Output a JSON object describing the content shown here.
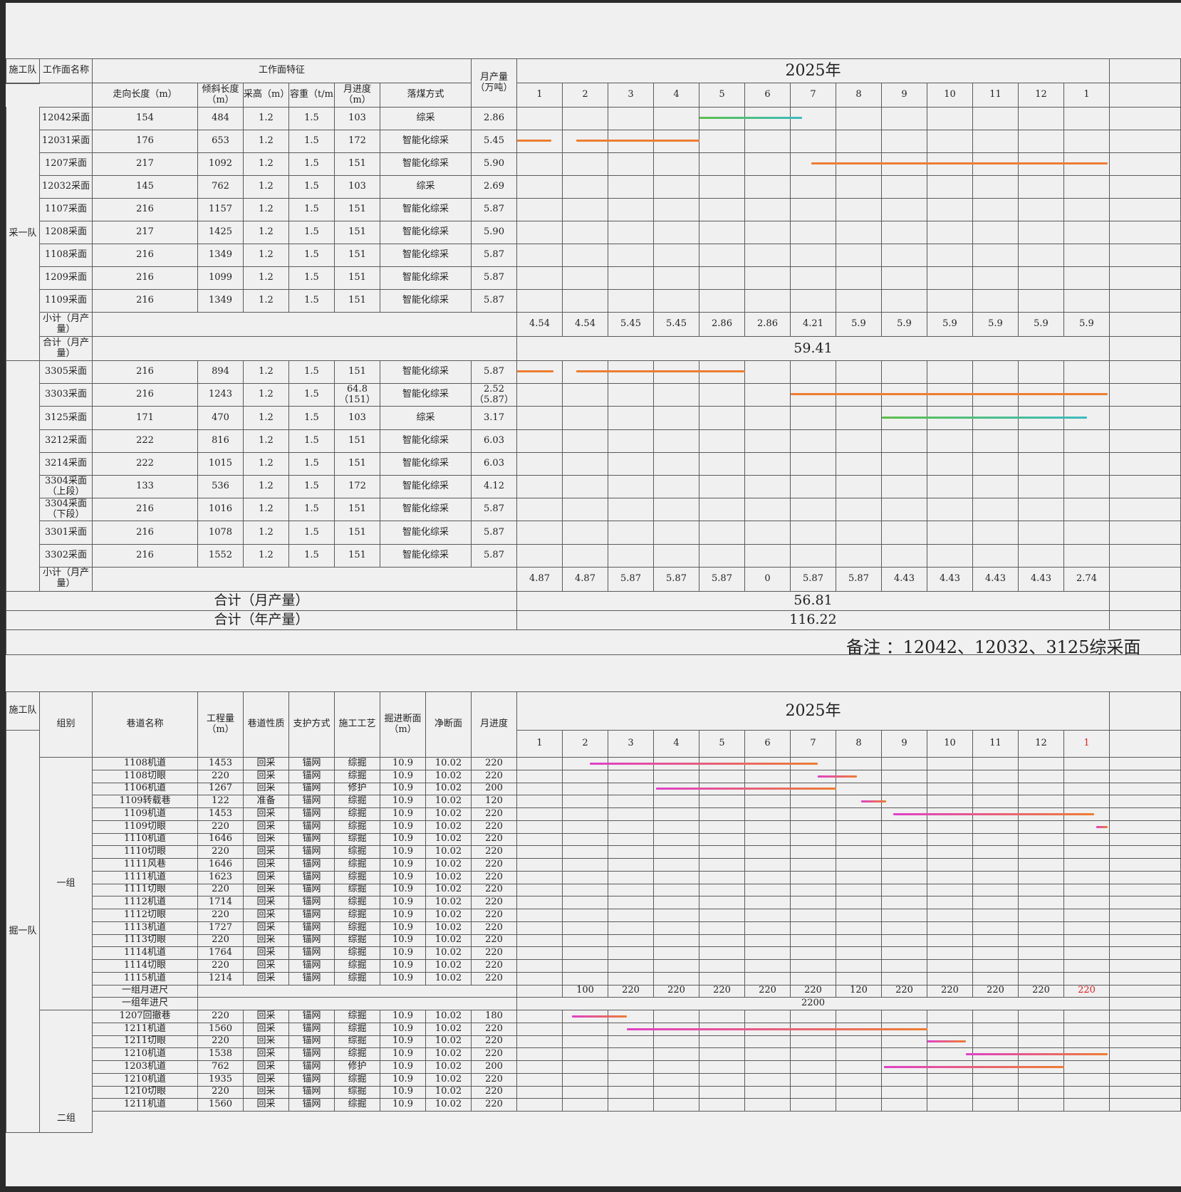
{
  "year_label": "2025年",
  "colors": {
    "orange": "#ed7d31",
    "green": "#5cbf4a",
    "teal": "#3cbcc0",
    "magenta": "#e040c8"
  },
  "months": [
    "1",
    "2",
    "3",
    "4",
    "5",
    "6",
    "7",
    "8",
    "9",
    "10",
    "11",
    "12",
    "1"
  ],
  "mining": {
    "header": {
      "team": "施工队",
      "face_name": "工作面名称",
      "features": "工作面特征",
      "monthly_output": "月产量\n（万吨）",
      "strike_length": "走向长度（m）",
      "incline_length": "倾斜长度\n（m）",
      "height": "采高（m）",
      "density": "容重（t/m",
      "monthly_advance": "月进度\n（m）",
      "method": "落煤方式"
    },
    "team1": "采一队",
    "group1_rows": [
      {
        "name": "12042采面",
        "strike": "154",
        "incline": "484",
        "height": "1.2",
        "density": "1.5",
        "advance": "103",
        "method": "综采",
        "output": "2.86"
      },
      {
        "name": "12031采面",
        "strike": "176",
        "incline": "653",
        "height": "1.2",
        "density": "1.5",
        "advance": "172",
        "method": "智能化综采",
        "output": "5.45"
      },
      {
        "name": "1207采面",
        "strike": "217",
        "incline": "1092",
        "height": "1.2",
        "density": "1.5",
        "advance": "151",
        "method": "智能化综采",
        "output": "5.90"
      },
      {
        "name": "12032采面",
        "strike": "145",
        "incline": "762",
        "height": "1.2",
        "density": "1.5",
        "advance": "103",
        "method": "综采",
        "output": "2.69"
      },
      {
        "name": "1107采面",
        "strike": "216",
        "incline": "1157",
        "height": "1.2",
        "density": "1.5",
        "advance": "151",
        "method": "智能化综采",
        "output": "5.87"
      },
      {
        "name": "1208采面",
        "strike": "217",
        "incline": "1425",
        "height": "1.2",
        "density": "1.5",
        "advance": "151",
        "method": "智能化综采",
        "output": "5.90"
      },
      {
        "name": "1108采面",
        "strike": "216",
        "incline": "1349",
        "height": "1.2",
        "density": "1.5",
        "advance": "151",
        "method": "智能化综采",
        "output": "5.87"
      },
      {
        "name": "1209采面",
        "strike": "216",
        "incline": "1099",
        "height": "1.2",
        "density": "1.5",
        "advance": "151",
        "method": "智能化综采",
        "output": "5.87"
      },
      {
        "name": "1109采面",
        "strike": "216",
        "incline": "1349",
        "height": "1.2",
        "density": "1.5",
        "advance": "151",
        "method": "智能化综采",
        "output": "5.87"
      }
    ],
    "subtotal_label": "小计（月产\n量）",
    "total_label": "合计（月产\n量）",
    "group1_subtotals": [
      "4.54",
      "4.54",
      "5.45",
      "5.45",
      "2.86",
      "2.86",
      "4.21",
      "5.9",
      "5.9",
      "5.9",
      "5.9",
      "5.9",
      "5.9"
    ],
    "group1_total": "59.41",
    "group2_rows": [
      {
        "name": "3305采面",
        "strike": "216",
        "incline": "894",
        "height": "1.2",
        "density": "1.5",
        "advance": "151",
        "method": "智能化综采",
        "output": "5.87"
      },
      {
        "name": "3303采面",
        "strike": "216",
        "incline": "1243",
        "height": "1.2",
        "density": "1.5",
        "advance": "64.8\n（151）",
        "method": "智能化综采",
        "output": "2.52\n（5.87）"
      },
      {
        "name": "3125采面",
        "strike": "171",
        "incline": "470",
        "height": "1.2",
        "density": "1.5",
        "advance": "103",
        "method": "综采",
        "output": "3.17"
      },
      {
        "name": "3212采面",
        "strike": "222",
        "incline": "816",
        "height": "1.2",
        "density": "1.5",
        "advance": "151",
        "method": "智能化综采",
        "output": "6.03"
      },
      {
        "name": "3214采面",
        "strike": "222",
        "incline": "1015",
        "height": "1.2",
        "density": "1.5",
        "advance": "151",
        "method": "智能化综采",
        "output": "6.03"
      },
      {
        "name": "3304采面\n（上段）",
        "strike": "133",
        "incline": "536",
        "height": "1.2",
        "density": "1.5",
        "advance": "172",
        "method": "智能化综采",
        "output": "4.12"
      },
      {
        "name": "3304采面\n（下段）",
        "strike": "216",
        "incline": "1016",
        "height": "1.2",
        "density": "1.5",
        "advance": "151",
        "method": "智能化综采",
        "output": "5.87"
      },
      {
        "name": "3301采面",
        "strike": "216",
        "incline": "1078",
        "height": "1.2",
        "density": "1.5",
        "advance": "151",
        "method": "智能化综采",
        "output": "5.87"
      },
      {
        "name": "3302采面",
        "strike": "216",
        "incline": "1552",
        "height": "1.2",
        "density": "1.5",
        "advance": "151",
        "method": "智能化综采",
        "output": "5.87"
      }
    ],
    "group2_subtotals": [
      "4.87",
      "4.87",
      "5.87",
      "5.87",
      "5.87",
      "0",
      "5.87",
      "5.87",
      "4.43",
      "4.43",
      "4.43",
      "4.43",
      "2.74"
    ],
    "grand_month_label": "合计（月产量）",
    "grand_month_value": "56.81",
    "grand_year_label": "合计（年产量）",
    "grand_year_value": "116.22",
    "note": "备注 ：12042、12032、3125综采面"
  },
  "tunnel": {
    "header": {
      "team": "施工队",
      "group": "组别",
      "name": "巷道名称",
      "quantity": "工程量\n（m）",
      "nature": "巷道性质",
      "support": "支护方式",
      "process": "施工工艺",
      "section": "掘进断面\n（m）",
      "net": "净断面",
      "advance": "月进度"
    },
    "team": "掘一队",
    "group1_label": "一组",
    "group2_label": "二组",
    "group1_rows": [
      {
        "name": "1108机道",
        "qty": "1453",
        "nature": "回采",
        "support": "锚网",
        "process": "综掘",
        "section": "10.9",
        "net": "10.02",
        "adv": "220"
      },
      {
        "name": "1108切眼",
        "qty": "220",
        "nature": "回采",
        "support": "锚网",
        "process": "综掘",
        "section": "10.9",
        "net": "10.02",
        "adv": "220"
      },
      {
        "name": "1106机道",
        "qty": "1267",
        "nature": "回采",
        "support": "锚网",
        "process": "修护",
        "section": "10.9",
        "net": "10.02",
        "adv": "200"
      },
      {
        "name": "1109转载巷",
        "qty": "122",
        "nature": "准备",
        "support": "锚网",
        "process": "综掘",
        "section": "10.9",
        "net": "10.02",
        "adv": "120"
      },
      {
        "name": "1109机道",
        "qty": "1453",
        "nature": "回采",
        "support": "锚网",
        "process": "综掘",
        "section": "10.9",
        "net": "10.02",
        "adv": "220"
      },
      {
        "name": "1109切眼",
        "qty": "220",
        "nature": "回采",
        "support": "锚网",
        "process": "综掘",
        "section": "10.9",
        "net": "10.02",
        "adv": "220"
      },
      {
        "name": "1110机道",
        "qty": "1646",
        "nature": "回采",
        "support": "锚网",
        "process": "综掘",
        "section": "10.9",
        "net": "10.02",
        "adv": "220"
      },
      {
        "name": "1110切眼",
        "qty": "220",
        "nature": "回采",
        "support": "锚网",
        "process": "综掘",
        "section": "10.9",
        "net": "10.02",
        "adv": "220"
      },
      {
        "name": "1111风巷",
        "qty": "1646",
        "nature": "回采",
        "support": "锚网",
        "process": "综掘",
        "section": "10.9",
        "net": "10.02",
        "adv": "220"
      },
      {
        "name": "1111机道",
        "qty": "1623",
        "nature": "回采",
        "support": "锚网",
        "process": "综掘",
        "section": "10.9",
        "net": "10.02",
        "adv": "220"
      },
      {
        "name": "1111切眼",
        "qty": "220",
        "nature": "回采",
        "support": "锚网",
        "process": "综掘",
        "section": "10.9",
        "net": "10.02",
        "adv": "220"
      },
      {
        "name": "1112机道",
        "qty": "1714",
        "nature": "回采",
        "support": "锚网",
        "process": "综掘",
        "section": "10.9",
        "net": "10.02",
        "adv": "220"
      },
      {
        "name": "1112切眼",
        "qty": "220",
        "nature": "回采",
        "support": "锚网",
        "process": "综掘",
        "section": "10.9",
        "net": "10.02",
        "adv": "220"
      },
      {
        "name": "1113机道",
        "qty": "1727",
        "nature": "回采",
        "support": "锚网",
        "process": "综掘",
        "section": "10.9",
        "net": "10.02",
        "adv": "220"
      },
      {
        "name": "1113切眼",
        "qty": "220",
        "nature": "回采",
        "support": "锚网",
        "process": "综掘",
        "section": "10.9",
        "net": "10.02",
        "adv": "220"
      },
      {
        "name": "1114机道",
        "qty": "1764",
        "nature": "回采",
        "support": "锚网",
        "process": "综掘",
        "section": "10.9",
        "net": "10.02",
        "adv": "220"
      },
      {
        "name": "1114切眼",
        "qty": "220",
        "nature": "回采",
        "support": "锚网",
        "process": "综掘",
        "section": "10.9",
        "net": "10.02",
        "adv": "220"
      },
      {
        "name": "1115机道",
        "qty": "1214",
        "nature": "回采",
        "support": "锚网",
        "process": "综掘",
        "section": "10.9",
        "net": "10.02",
        "adv": "220"
      }
    ],
    "group1_month_label": "一组月进尺",
    "group1_month_values": [
      "",
      "100",
      "220",
      "220",
      "220",
      "220",
      "220",
      "120",
      "220",
      "220",
      "220",
      "220",
      "220"
    ],
    "group1_year_label": "一组年进尺",
    "group1_year_value": "2200",
    "group2_rows": [
      {
        "name": "1207回撤巷",
        "qty": "220",
        "nature": "回采",
        "support": "锚网",
        "process": "综掘",
        "section": "10.9",
        "net": "10.02",
        "adv": "180"
      },
      {
        "name": "1211机道",
        "qty": "1560",
        "nature": "回采",
        "support": "锚网",
        "process": "综掘",
        "section": "10.9",
        "net": "10.02",
        "adv": "220"
      },
      {
        "name": "1211切眼",
        "qty": "220",
        "nature": "回采",
        "support": "锚网",
        "process": "综掘",
        "section": "10.9",
        "net": "10.02",
        "adv": "220"
      },
      {
        "name": "1210机道",
        "qty": "1538",
        "nature": "回采",
        "support": "锚网",
        "process": "综掘",
        "section": "10.9",
        "net": "10.02",
        "adv": "220"
      },
      {
        "name": "1203机道",
        "qty": "762",
        "nature": "回采",
        "support": "锚网",
        "process": "修护",
        "section": "10.9",
        "net": "10.02",
        "adv": "200"
      },
      {
        "name": "1210机道",
        "qty": "1935",
        "nature": "回采",
        "support": "锚网",
        "process": "综掘",
        "section": "10.9",
        "net": "10.02",
        "adv": "220"
      },
      {
        "name": "1210切眼",
        "qty": "220",
        "nature": "回采",
        "support": "锚网",
        "process": "综掘",
        "section": "10.9",
        "net": "10.02",
        "adv": "220"
      },
      {
        "name": "1211机道",
        "qty": "1560",
        "nature": "回采",
        "support": "锚网",
        "process": "综掘",
        "section": "10.9",
        "net": "10.02",
        "adv": "220"
      }
    ]
  },
  "schedule": {
    "mining_group1": [
      {
        "row": 0,
        "start": 5.0,
        "end": 7.25,
        "color": "green",
        "color2": "teal"
      },
      {
        "row": 1,
        "start": 1.0,
        "end": 1.75,
        "color": "orange"
      },
      {
        "row": 1,
        "start": 2.3,
        "end": 5.0,
        "color": "orange"
      },
      {
        "row": 2,
        "start": 7.45,
        "end": 13.95,
        "color": "orange"
      }
    ],
    "mining_group2": [
      {
        "row": 0,
        "start": 1.0,
        "end": 1.8,
        "color": "orange"
      },
      {
        "row": 0,
        "start": 2.3,
        "end": 6.0,
        "color": "orange"
      },
      {
        "row": 1,
        "start": 7.0,
        "end": 13.95,
        "color": "orange"
      },
      {
        "row": 2,
        "start": 9.0,
        "end": 13.5,
        "color": "green",
        "color2": "teal"
      }
    ],
    "tunnel_group1": [
      {
        "row": 0,
        "start": 2.6,
        "end": 7.6
      },
      {
        "row": 1,
        "start": 7.6,
        "end": 8.45
      },
      {
        "row": 2,
        "start": 4.05,
        "end": 8.0
      },
      {
        "row": 3,
        "start": 8.55,
        "end": 9.1
      },
      {
        "row": 4,
        "start": 9.25,
        "end": 13.65
      },
      {
        "row": 5,
        "start": 13.7,
        "end": 13.95
      }
    ],
    "tunnel_group2": [
      {
        "row": 0,
        "start": 2.2,
        "end": 3.4
      },
      {
        "row": 1,
        "start": 3.4,
        "end": 10.0
      },
      {
        "row": 2,
        "start": 10.0,
        "end": 10.85
      },
      {
        "row": 3,
        "start": 10.85,
        "end": 13.95
      },
      {
        "row": 4,
        "start": 9.05,
        "end": 13.0
      }
    ]
  },
  "red_month_value_index": 12
}
